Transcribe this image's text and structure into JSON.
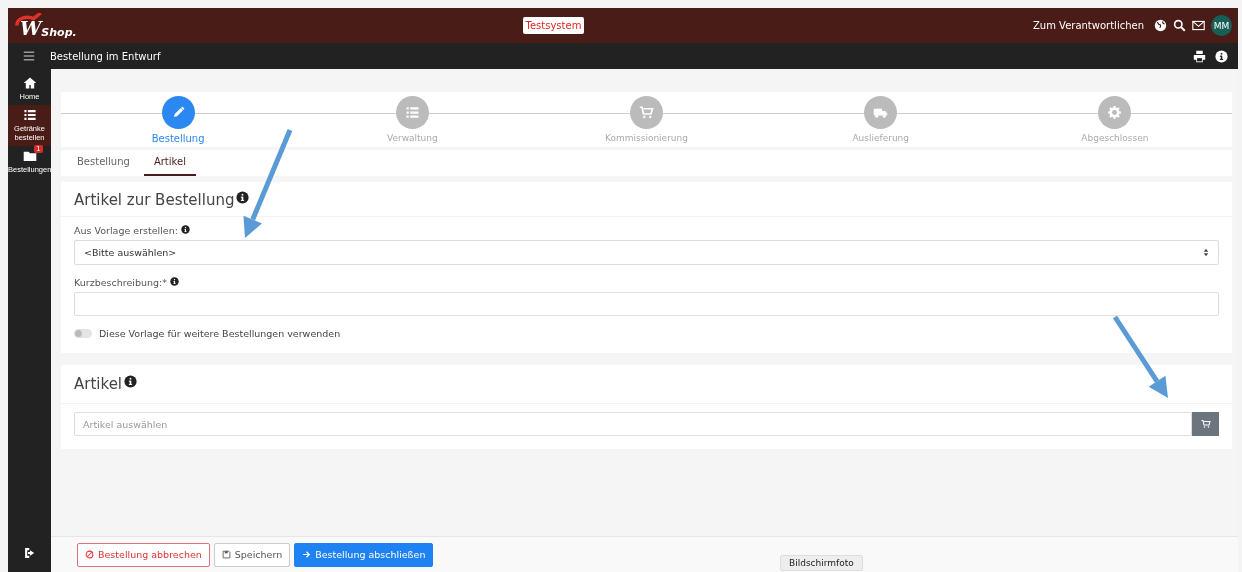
{
  "header": {
    "logo_mark": "W",
    "logo_text": "Shop.",
    "environment_badge": "Testsystem",
    "responsible_link": "Zum Verantwortlichen",
    "avatar": "MM"
  },
  "toolbar": {
    "title": "Bestellung im Entwurf"
  },
  "sidebar": {
    "items": [
      {
        "kind": "home",
        "label": "Home",
        "selected": false
      },
      {
        "kind": "list",
        "label": "Getränke bestellen",
        "selected": true
      },
      {
        "kind": "folder",
        "label": "Bestellungen",
        "selected": false,
        "badge": "1"
      },
      {
        "kind": "logout",
        "selected": false
      }
    ]
  },
  "steps": [
    {
      "kind": "pencil",
      "label": "Bestellung",
      "selected": true
    },
    {
      "kind": "list",
      "label": "Verwaltung",
      "selected": false
    },
    {
      "kind": "cart",
      "label": "Kommissionierung",
      "selected": false
    },
    {
      "kind": "truck",
      "label": "Auslieferung",
      "selected": false
    },
    {
      "kind": "gear",
      "label": "Abgeschlossen",
      "selected": false
    }
  ],
  "tabs": [
    {
      "label": "Bestellung",
      "selected": false
    },
    {
      "label": "Artikel",
      "selected": true
    }
  ],
  "order_panel": {
    "title": "Artikel zur Bestellung",
    "template_label": "Aus Vorlage erstellen:",
    "template_value": "<Bitte auswählen>",
    "description_label": "Kurzbeschreibung:*",
    "reuse_toggle": {
      "label": "Diese Vorlage für weitere Bestellungen verwenden",
      "on": false
    }
  },
  "article_panel": {
    "title": "Artikel",
    "placeholder": "Artikel auswählen"
  },
  "footer_buttons": [
    {
      "kind": "cancel",
      "label": "Bestellung abbrechen"
    },
    {
      "kind": "save",
      "label": "Speichern"
    },
    {
      "kind": "submit",
      "label": "Bestellung abschließen"
    }
  ],
  "tooltip": "Bildschirmfoto",
  "annotations": [
    {
      "kind": "arrow"
    },
    {
      "kind": "arrow"
    }
  ]
}
